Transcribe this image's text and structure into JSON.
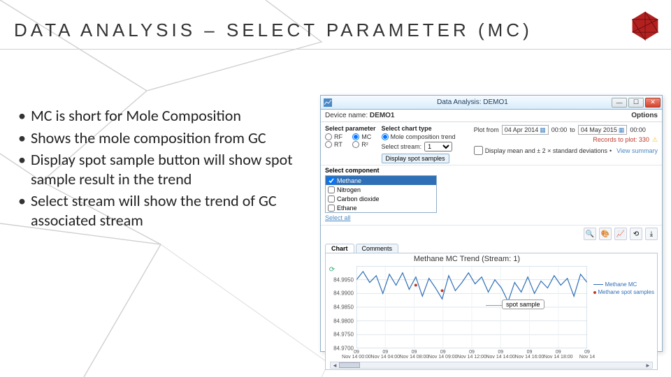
{
  "slide": {
    "title": "Data Analysis – Select Parameter (mc)",
    "bullets": [
      "MC is short for Mole Composition",
      "Shows the mole composition from GC",
      "Display spot sample button will show spot sample result in the trend",
      "Select stream will show the trend of GC associated stream"
    ]
  },
  "app": {
    "window_title": "Data Analysis: DEMO1",
    "device_label": "Device name:",
    "device_name": "DEMO1",
    "options_label": "Options",
    "select_parameter_label": "Select parameter",
    "params": {
      "rf": "RF",
      "mc": "MC",
      "rt": "RT",
      "r2": "R²"
    },
    "select_chart_type_label": "Select chart type",
    "chart_type_option": "Mole composition trend",
    "select_stream_label": "Select stream:",
    "stream_value": "1",
    "display_spot_btn": "Display spot samples",
    "select_component_label": "Select component",
    "components": [
      {
        "name": "Methane",
        "checked": true,
        "selected": true
      },
      {
        "name": "Nitrogen",
        "checked": false,
        "selected": false
      },
      {
        "name": "Carbon dioxide",
        "checked": false,
        "selected": false
      },
      {
        "name": "Ethane",
        "checked": false,
        "selected": false
      }
    ],
    "select_all": "Select all",
    "plot_from_label": "Plot from",
    "date_from": "04 Apr 2014",
    "time_from": "00:00",
    "to_label": "to",
    "date_to": "04 May 2015",
    "time_to": "00:00",
    "records_text": "Records to plot: 330",
    "display_mean_label": "Display mean and ± 2 × standard deviations",
    "view_summary": "View summary",
    "tabs": {
      "chart": "Chart",
      "comments": "Comments"
    },
    "chart_title": "Methane MC Trend (Stream: 1)",
    "legend": {
      "line": "Methane MC",
      "dots": "Methane spot samples"
    },
    "annotation": "spot sample"
  },
  "chart_data": {
    "type": "line",
    "title": "Methane MC Trend (Stream: 1)",
    "xlabel": "",
    "ylabel": "",
    "ylim": [
      84.97,
      85.0
    ],
    "yticks": [
      84.97,
      84.975,
      84.98,
      84.985,
      84.99,
      84.995
    ],
    "x": [
      "09 Nov 14 00:00",
      "09 Nov 14 04:00",
      "09 Nov 14 08:00",
      "09 Nov 14 09:00",
      "09 Nov 14 12:00",
      "09 Nov 14 14:00",
      "09 Nov 14 16:00",
      "09 Nov 14 18:00",
      "09 Nov 14"
    ],
    "series": [
      {
        "name": "Methane MC",
        "values": [
          84.995,
          84.998,
          84.994,
          84.9965,
          84.99,
          84.997,
          84.993,
          84.9975,
          84.9915,
          84.996,
          84.989,
          84.9955,
          84.992,
          84.988,
          84.9965,
          84.991,
          84.994,
          84.9975,
          84.9935,
          84.996,
          84.9905,
          84.995,
          84.992,
          84.987,
          84.994,
          84.9905,
          84.996,
          84.99,
          84.9945,
          84.992,
          84.9965,
          84.993,
          84.9955,
          84.989,
          84.997,
          84.994
        ],
        "color": "#2f6fb6"
      },
      {
        "name": "Methane spot samples",
        "type": "scatter",
        "x_indices": [
          9,
          13
        ],
        "values": [
          84.993,
          84.991
        ],
        "color": "#c0392b"
      }
    ],
    "annotations": [
      {
        "text": "spot sample",
        "x_index": 13,
        "y": 84.991
      }
    ]
  }
}
